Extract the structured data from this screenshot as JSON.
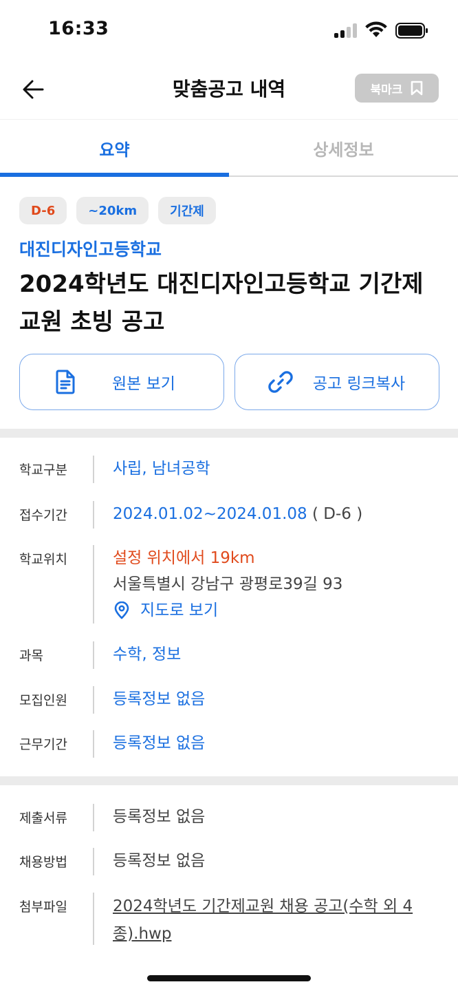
{
  "status": {
    "time": "16:33"
  },
  "nav": {
    "title": "맞춤공고 내역",
    "bookmark_label": "북마크"
  },
  "tabs": [
    {
      "label": "요약",
      "active": true
    },
    {
      "label": "상세정보",
      "active": false
    }
  ],
  "tags": {
    "dday": "D-6",
    "distance": "~20km",
    "type": "기간제"
  },
  "school_name": "대진디자인고등학교",
  "post_title": "2024학년도 대진디자인고등학교 기간제 교원 초빙 공고",
  "actions": {
    "original": "원본 보기",
    "copy_link": "공고 링크복사"
  },
  "info": {
    "school_type": {
      "label": "학교구분",
      "value": "사립, 남녀공학"
    },
    "application_period": {
      "label": "접수기간",
      "value": "2024.01.02~2024.01.08",
      "dday": " ( D-6 )"
    },
    "location": {
      "label": "학교위치",
      "distance_text": "설정 위치에서 19km",
      "address": "서울특별시 강남구 광평로39길 93",
      "map_link": "지도로 보기"
    },
    "subject": {
      "label": "과목",
      "value": "수학, 정보"
    },
    "headcount": {
      "label": "모집인원",
      "value": "등록정보 없음"
    },
    "work_period": {
      "label": "근무기간",
      "value": "등록정보 없음"
    }
  },
  "extra": {
    "documents": {
      "label": "제출서류",
      "value": "등록정보 없음"
    },
    "hiring_method": {
      "label": "채용방법",
      "value": "등록정보 없음"
    },
    "attachment": {
      "label": "첨부파일",
      "value": "2024학년도 기간제교원 채용 공고(수학 외 4종).hwp"
    }
  },
  "colors": {
    "accent": "#1a6fe0",
    "alert": "#e04a1c",
    "tag_bg": "#ececec",
    "divider": "#ebebeb"
  }
}
